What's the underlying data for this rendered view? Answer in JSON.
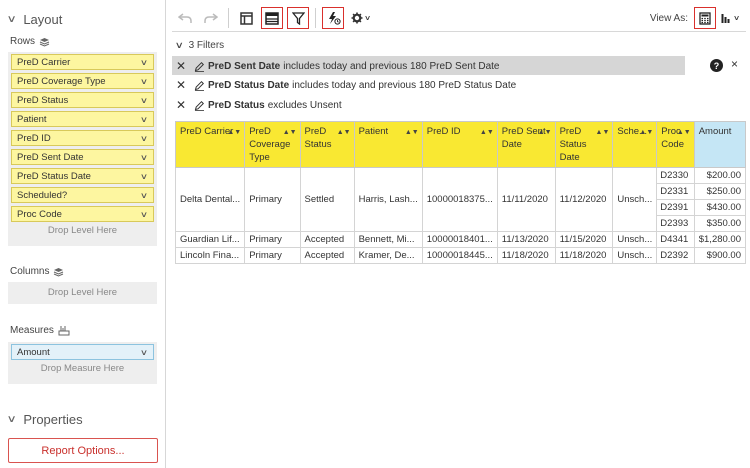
{
  "layout": {
    "title": "Layout",
    "rows_label": "Rows",
    "rows": [
      "PreD Carrier",
      "PreD Coverage Type",
      "PreD Status",
      "Patient",
      "PreD ID",
      "PreD Sent Date",
      "PreD Status Date",
      "Scheduled?",
      "Proc Code"
    ],
    "rows_drop": "Drop Level Here",
    "columns_label": "Columns",
    "columns_drop": "Drop Level Here",
    "measures_label": "Measures",
    "measures": [
      "Amount"
    ],
    "measures_drop": "Drop Measure Here"
  },
  "properties": {
    "title": "Properties",
    "report_button": "Report Options..."
  },
  "toolbar": {
    "view_as": "View As:"
  },
  "filters": {
    "header": "3 Filters",
    "items": [
      {
        "name": "PreD Sent Date",
        "text": "includes today and previous 180 PreD Sent Date"
      },
      {
        "name": "PreD Status Date",
        "text": "includes today and previous 180 PreD Status Date"
      },
      {
        "name": "PreD Status",
        "text": "excludes Unsent"
      }
    ],
    "help": "?",
    "close": "×"
  },
  "grid": {
    "columns": [
      "PreD Carrier",
      "PreD Coverage Type",
      "PreD Status",
      "Patient",
      "PreD ID",
      "PreD Sent Date",
      "PreD Status Date",
      "Sche...",
      "Proc Code",
      "Amount"
    ],
    "rows": [
      {
        "carrier": "Delta Dental...",
        "coverage": "Primary",
        "status": "Settled",
        "patient": "Harris, Lash...",
        "id": "10000018375...",
        "sent": "11/11/2020",
        "status_date": "11/12/2020",
        "sched": "Unsch...",
        "procs": [
          {
            "code": "D2330",
            "amount": "$200.00"
          },
          {
            "code": "D2331",
            "amount": "$250.00"
          },
          {
            "code": "D2391",
            "amount": "$430.00"
          },
          {
            "code": "D2393",
            "amount": "$350.00"
          }
        ]
      },
      {
        "carrier": "Guardian Lif...",
        "coverage": "Primary",
        "status": "Accepted",
        "patient": "Bennett, Mi...",
        "id": "10000018401...",
        "sent": "11/13/2020",
        "status_date": "11/15/2020",
        "sched": "Unsch...",
        "procs": [
          {
            "code": "D4341",
            "amount": "$1,280.00"
          }
        ]
      },
      {
        "carrier": "Lincoln Fina...",
        "coverage": "Primary",
        "status": "Accepted",
        "patient": "Kramer, De...",
        "id": "10000018445...",
        "sent": "11/18/2020",
        "status_date": "11/18/2020",
        "sched": "Unsch...",
        "procs": [
          {
            "code": "D2392",
            "amount": "$900.00"
          }
        ]
      }
    ]
  }
}
